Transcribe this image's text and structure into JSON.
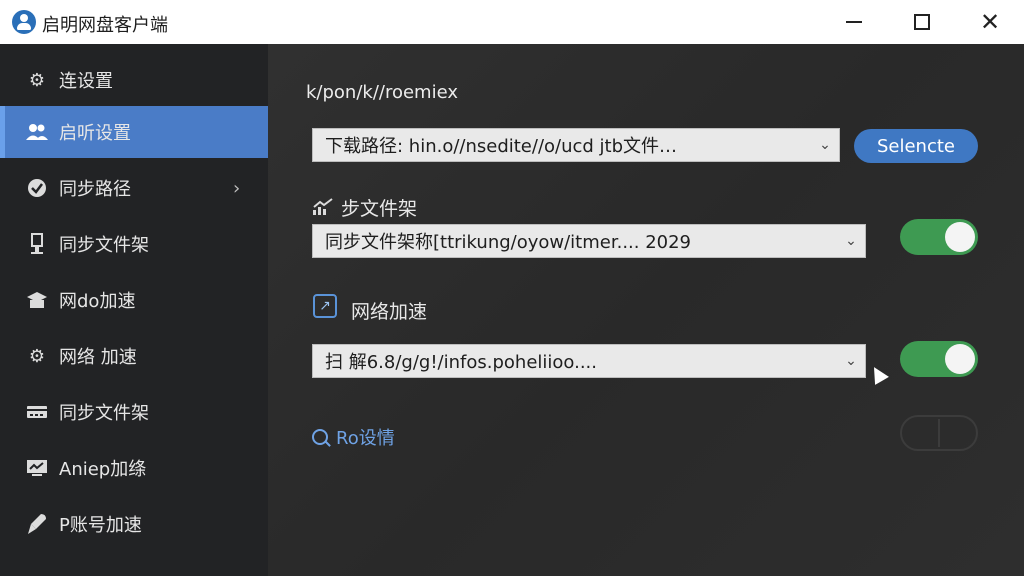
{
  "window": {
    "title": "启明网盘客户端",
    "controls": {
      "minimize": "minimize",
      "maximize": "maximize",
      "close": "✕"
    }
  },
  "sidebar": {
    "items": [
      {
        "label": "连设置",
        "icon": "gear-icon",
        "active": false
      },
      {
        "label": "启听设置",
        "icon": "users-icon",
        "active": true
      },
      {
        "label": "同步路径",
        "icon": "check-circle-icon",
        "active": false,
        "chevron": "›"
      },
      {
        "label": "同步文件架",
        "icon": "plug-icon",
        "active": false
      },
      {
        "label": "网do加速",
        "icon": "cap-icon",
        "active": false
      },
      {
        "label": "网络 加速",
        "icon": "gear-icon",
        "active": false
      },
      {
        "label": "同步文件架",
        "icon": "card-icon",
        "active": false
      },
      {
        "label": "Aniep加绦",
        "icon": "monitor-icon",
        "active": false
      },
      {
        "label": "P账号加速",
        "icon": "rocket-icon",
        "active": false
      }
    ]
  },
  "main": {
    "path_heading": "k/pon/k//roemiex",
    "download_path": {
      "value": "下载路径: hin.o//nsedite//o/ucd jtb文件…",
      "button_label": "Selencte"
    },
    "sync_section": {
      "label": "步文件架",
      "value": "同步文件架称[ttrikung/oyow/itmer.... 2029",
      "toggle": "on"
    },
    "network_section": {
      "label": "网络加速",
      "value": "扫 解6.8/g/g!/infos.poheliioo....",
      "toggle": "on"
    },
    "link": {
      "label": "Ro设情",
      "toggle": "off"
    }
  },
  "colors": {
    "accent": "#4a7cc7",
    "button": "#3f78c3",
    "toggle_on": "#3e9a52",
    "sidebar_bg": "#222325",
    "main_bg": "#2b2b2b"
  }
}
